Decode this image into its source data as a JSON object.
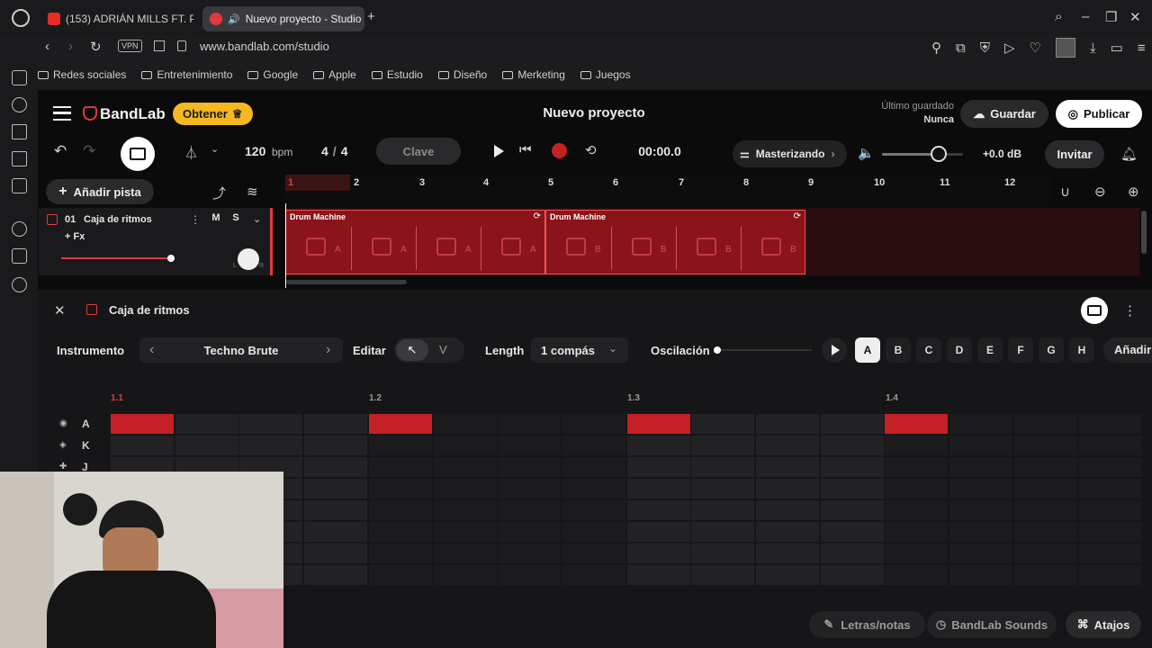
{
  "browser": {
    "tabs": [
      {
        "title": "(153) ADRIÁN MILLS FT. P..."
      },
      {
        "title": "Nuevo proyecto - Studio"
      }
    ],
    "url": "www.bandlab.com/studio",
    "vpn_label": "VPN",
    "bookmarks": [
      "Redes sociales",
      "Entretenimiento",
      "Google",
      "Apple",
      "Estudio",
      "Diseño",
      "Merketing",
      "Juegos"
    ]
  },
  "header": {
    "brand": "BandLab",
    "obtener_label": "Obtener",
    "project_title": "Nuevo proyecto",
    "last_saved_label": "Último guardado",
    "last_saved_value": "Nunca",
    "save_label": "Guardar",
    "publish_label": "Publicar"
  },
  "transport": {
    "bpm_value": "120",
    "bpm_unit": "bpm",
    "time_sig_num": "4",
    "time_sig_sep": "/",
    "time_sig_den": "4",
    "key_label": "Clave",
    "time": "00:00.0",
    "mastering_label": "Masterizando",
    "volume_db": "+0.0 dB",
    "invite_label": "Invitar",
    "volume_level": 0.7
  },
  "tracks": {
    "add_label": "Añadir pista",
    "items": [
      {
        "number": "01",
        "name": "Caja de ritmos",
        "fx_label": "+ Fx",
        "mute": "M",
        "solo": "S",
        "pan_l": "L",
        "pan_r": "R"
      }
    ]
  },
  "ruler": {
    "bars": [
      "1",
      "2",
      "3",
      "4",
      "5",
      "6",
      "7",
      "8",
      "9",
      "10",
      "11",
      "12"
    ]
  },
  "clips": [
    {
      "title": "Drum Machine",
      "pattern": "A",
      "beats": 4
    },
    {
      "title": "Drum Machine",
      "pattern": "B",
      "beats": 4
    }
  ],
  "editor": {
    "title": "Caja de ritmos",
    "instrument_label": "Instrumento",
    "instrument_value": "Techno Brute",
    "edit_label": "Editar",
    "edit_mode_v": "V",
    "length_label": "Length",
    "length_value": "1 compás",
    "swing_label": "Oscilación",
    "patterns": [
      "A",
      "B",
      "C",
      "D",
      "E",
      "F",
      "G",
      "H"
    ],
    "selected_pattern": "A",
    "add_label": "Añadir",
    "beat_labels": [
      "1.1",
      "1.2",
      "1.3",
      "1.4"
    ],
    "rows": [
      {
        "letter": "A",
        "steps": [
          1,
          0,
          0,
          0,
          1,
          0,
          0,
          0,
          1,
          0,
          0,
          0,
          1,
          0,
          0,
          0
        ]
      },
      {
        "letter": "K",
        "steps": [
          0,
          0,
          0,
          0,
          0,
          0,
          0,
          0,
          0,
          0,
          0,
          0,
          0,
          0,
          0,
          0
        ]
      },
      {
        "letter": "J",
        "steps": [
          0,
          0,
          0,
          0,
          0,
          0,
          0,
          0,
          0,
          0,
          0,
          0,
          0,
          0,
          0,
          0
        ]
      }
    ]
  },
  "footer": {
    "lyrics_label": "Letras/notas",
    "sounds_label": "BandLab Sounds",
    "shortcuts_label": "Atajos"
  },
  "colors": {
    "accent": "#e03a3e",
    "obtener_bg": "#f5b820",
    "active_step": "#c52026"
  }
}
